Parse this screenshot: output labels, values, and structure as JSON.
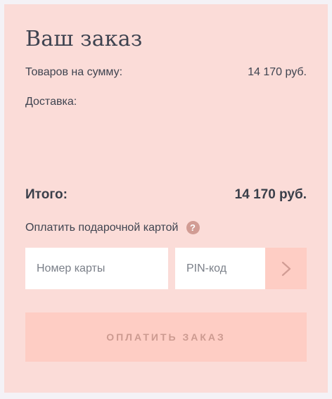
{
  "order": {
    "title": "Ваш заказ",
    "goods_label": "Товаров на сумму:",
    "goods_value": "14 170 руб.",
    "delivery_label": "Доставка:",
    "delivery_value": "",
    "total_label": "Итого:",
    "total_value": "14 170 руб."
  },
  "gift_card": {
    "label": "Оплатить подарочной картой",
    "help_icon": "?",
    "card_number_placeholder": "Номер карты",
    "pin_placeholder": "PIN-код",
    "submit_icon": "chevron-right-icon"
  },
  "pay_button": {
    "label": "ОПЛАТИТЬ ЗАКАЗ"
  },
  "colors": {
    "card_background": "#fbdcd8",
    "accent": "#fecdc4",
    "muted_accent_text": "#cc9a90",
    "help_icon": "#d19c94"
  }
}
